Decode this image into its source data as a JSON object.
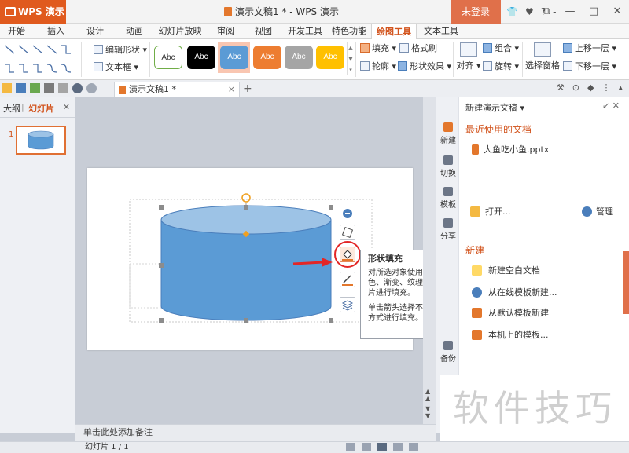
{
  "app": {
    "name": "WPS 演示",
    "caret": "▾"
  },
  "title": "演示文稿1 * - WPS 演示",
  "login": "未登录",
  "titlebar_icons": [
    "👕",
    "♥",
    "?",
    "-"
  ],
  "window_buttons": [
    "⧉",
    "—",
    "□",
    "✕"
  ],
  "menu_tabs": [
    "开始",
    "插入",
    "设计",
    "动画",
    "幻灯片放映",
    "审阅",
    "视图",
    "开发工具",
    "特色功能",
    "绘图工具",
    "文本工具"
  ],
  "menu_active": "绘图工具",
  "ribbon": {
    "edit_shape": "编辑形状",
    "text_box": "文本框",
    "style_label": "Abc",
    "fill": "填充",
    "format_brush": "格式刷",
    "outline": "轮廓",
    "shape_effect": "形状效果",
    "align": "对齐",
    "group": "组合",
    "rotate": "旋转",
    "selection_pane": "选择窗格",
    "bring_forward": "上移一层",
    "send_backward": "下移一层"
  },
  "doc_tab": {
    "label": "演示文稿1 *",
    "close": "×"
  },
  "add_tab": "+",
  "left_panel": {
    "outline": "大纲",
    "slides": "幻灯片",
    "close": "✕",
    "slide_number": "1"
  },
  "tooltip": {
    "title": "形状填充",
    "desc1": "对所选对象使用颜色、渐变、纹理、图片进行填充。",
    "desc2": "单击箭头选择不同的方式进行填充。"
  },
  "notes_placeholder": "单击此处添加备注",
  "side_icons": [
    "新建",
    "切换",
    "模板",
    "分享",
    "备份"
  ],
  "taskpane": {
    "header": "新建演示文稿 ▾",
    "header_btns": "↙  ✕",
    "recent_title": "最近使用的文档",
    "recent_file": "大鱼吃小鱼.pptx",
    "open": "打开...",
    "manage": "管理",
    "new_title": "新建",
    "new_blank": "新建空白文档",
    "from_online": "从在线模板新建...",
    "from_default": "从默认模板新建",
    "local_template": "本机上的模板..."
  },
  "status": {
    "slide_info": "幻灯片 1 / 1"
  },
  "watermark": "软件技巧",
  "colors": {
    "accent": "#e05a1e",
    "shape_fill": "#5b9bd5",
    "shape_top": "#9dc3e6",
    "highlight_red": "#e32626"
  }
}
